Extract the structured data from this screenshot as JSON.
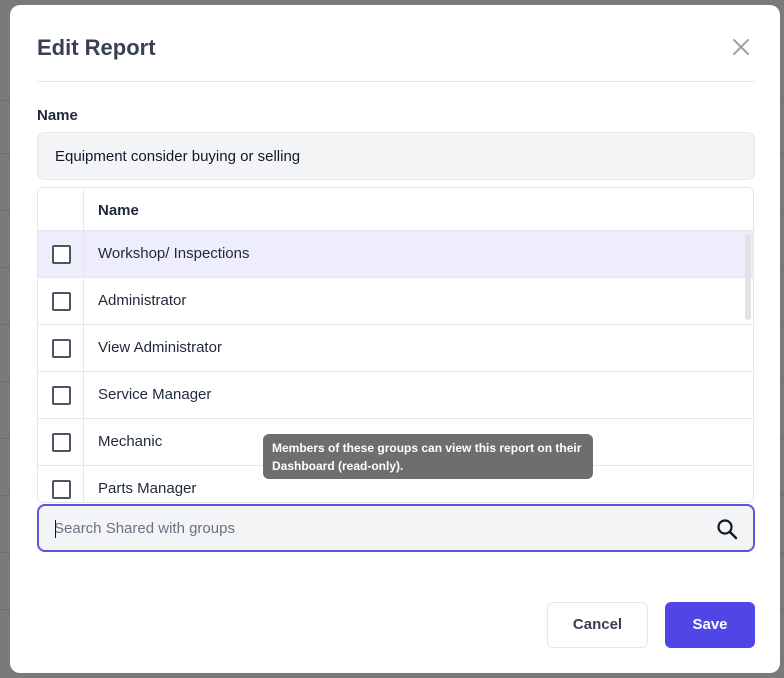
{
  "dialog": {
    "title": "Edit Report",
    "name_label": "Name",
    "name_value": "Equipment consider buying or selling"
  },
  "groups_table": {
    "column_header": "Name",
    "rows": [
      {
        "label": "Workshop/ Inspections",
        "checked": false
      },
      {
        "label": "Administrator",
        "checked": false
      },
      {
        "label": "View Administrator",
        "checked": false
      },
      {
        "label": "Service Manager",
        "checked": false
      },
      {
        "label": "Mechanic",
        "checked": false
      },
      {
        "label": "Parts Manager",
        "checked": false
      }
    ]
  },
  "tooltip": {
    "text": "Members of these groups can view this report on their Dashboard (read-only)."
  },
  "search": {
    "value": "",
    "placeholder": "Search Shared with groups",
    "icon": "search-icon"
  },
  "footer": {
    "cancel_label": "Cancel",
    "save_label": "Save"
  },
  "colors": {
    "accent": "#4f46e5",
    "highlight_row": "#ededfb",
    "overlay": "#7a7a7a"
  }
}
